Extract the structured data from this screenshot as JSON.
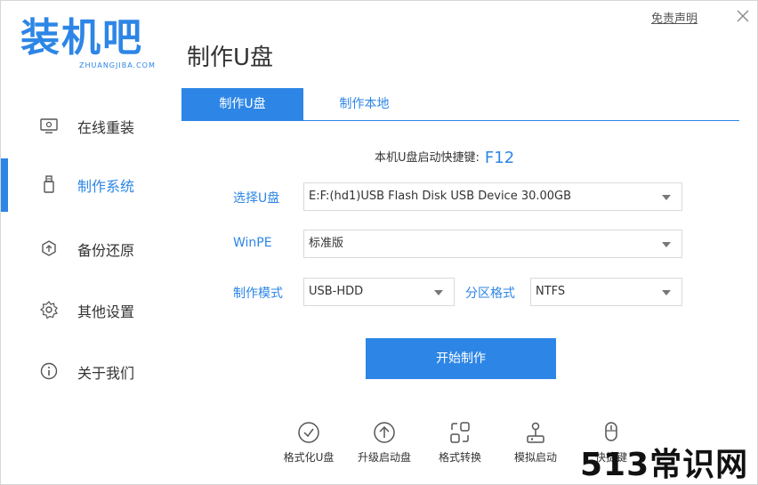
{
  "logo": {
    "main": "装机吧",
    "sub": "ZHUANGJIBA.COM",
    "color": "#2d86e6"
  },
  "titlebar": {
    "disclaimer": "免责声明",
    "close_icon": "close-icon"
  },
  "page_title": "制作U盘",
  "sidebar": {
    "items": [
      {
        "label": "在线重装",
        "icon": "monitor-icon",
        "active": false
      },
      {
        "label": "制作系统",
        "icon": "usb-icon",
        "active": true
      },
      {
        "label": "备份还原",
        "icon": "backup-icon",
        "active": false
      },
      {
        "label": "其他设置",
        "icon": "gear-icon",
        "active": false
      },
      {
        "label": "关于我们",
        "icon": "info-icon",
        "active": false
      }
    ]
  },
  "tabs": [
    {
      "label": "制作U盘",
      "active": true
    },
    {
      "label": "制作本地",
      "active": false
    }
  ],
  "hotkey": {
    "label": "本机U盘启动快捷键:",
    "key": "F12"
  },
  "form": {
    "usb_label": "选择U盘",
    "usb_value": "E:F:(hd1)USB Flash Disk USB Device 30.00GB",
    "winpe_label": "WinPE",
    "winpe_value": "标准版",
    "mode_label": "制作模式",
    "mode_value": "USB-HDD",
    "partition_label": "分区格式",
    "partition_value": "NTFS"
  },
  "start_button": "开始制作",
  "tools": [
    {
      "label": "格式化U盘",
      "icon": "check-circle-icon"
    },
    {
      "label": "升级启动盘",
      "icon": "upload-circle-icon"
    },
    {
      "label": "格式转换",
      "icon": "convert-icon"
    },
    {
      "label": "模拟启动",
      "icon": "joystick-icon"
    },
    {
      "label": "快捷键",
      "icon": "mouse-icon"
    }
  ],
  "watermark": "513常识网",
  "colors": {
    "accent": "#2d86e6",
    "text": "#333333",
    "border": "#d9d9d9"
  }
}
